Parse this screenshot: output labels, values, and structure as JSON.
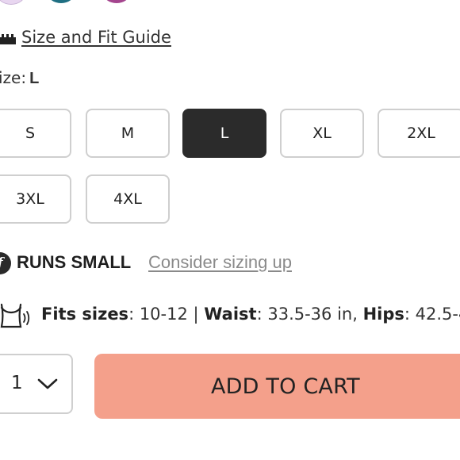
{
  "color_swatches": [
    {
      "name": "lavender",
      "color": "#e8d6f0"
    },
    {
      "name": "teal",
      "color": "#1f6f82"
    },
    {
      "name": "magenta",
      "color": "#a4458e"
    }
  ],
  "size_guide": {
    "label": "Size and Fit Guide",
    "icon": "ruler-icon"
  },
  "size_selector": {
    "label": "ize:",
    "selected": "L",
    "options": [
      "S",
      "M",
      "L",
      "XL",
      "2XL",
      "3XL",
      "4XL"
    ]
  },
  "fit_note": {
    "icon_letter": "f",
    "headline": "RUNS SMALL",
    "link": "Consider sizing up"
  },
  "fit_details": {
    "fits_label": "Fits sizes",
    "fits_value": ": 10-12 | ",
    "waist_label": "Waist",
    "waist_value": ": 33.5-36 in, ",
    "hips_label": "Hips",
    "hips_value": ": 42.5-4"
  },
  "quantity": {
    "value": "1"
  },
  "add_to_cart": {
    "label": "ADD TO CART",
    "color": "#f4a08b"
  }
}
